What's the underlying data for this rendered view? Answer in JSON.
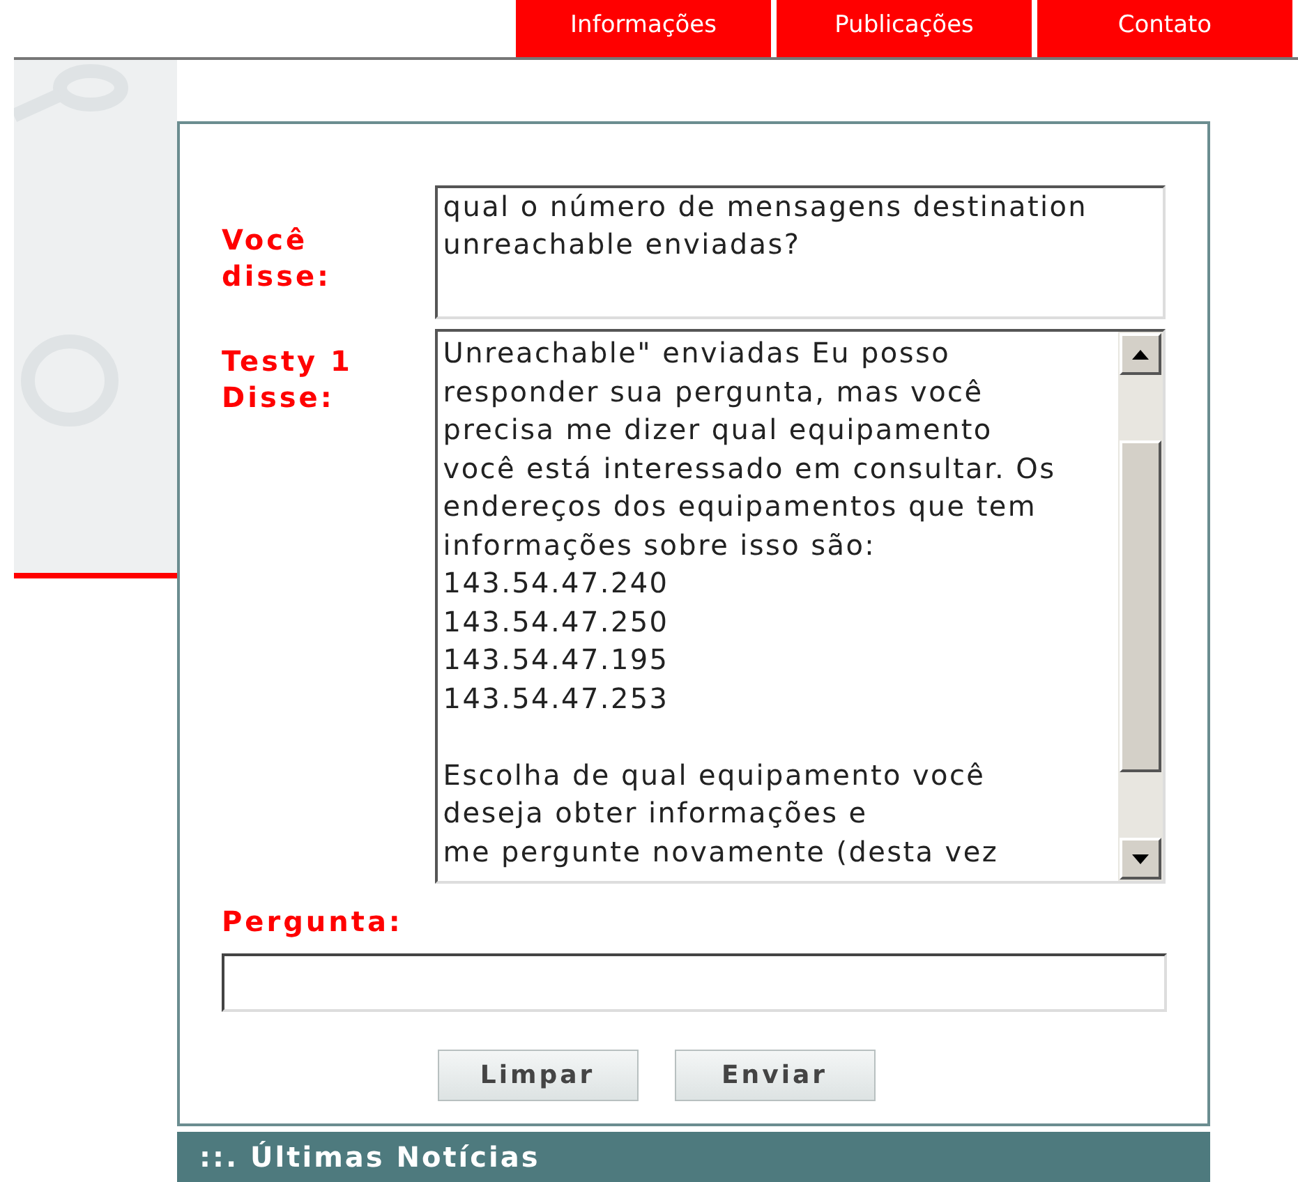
{
  "nav": {
    "tabs": [
      {
        "label": "Informações"
      },
      {
        "label": "Publicações"
      },
      {
        "label": "Contato"
      }
    ]
  },
  "chat": {
    "user_label": "Você disse:",
    "user_message": "qual o número de mensagens destination unreachable enviadas?",
    "bot_label": "Testy 1 Disse:",
    "bot_paragraphs": [
      [
        "Unreachable\" enviadas Eu posso",
        "responder sua pergunta, mas você",
        "precisa me dizer qual equipamento",
        "você está interessado em consultar. Os",
        "endereços dos equipamentos que tem",
        "informações sobre isso são:",
        "143.54.47.240",
        "143.54.47.250",
        "143.54.47.195",
        "143.54.47.253"
      ],
      [
        "Escolha de qual equipamento você",
        "deseja obter informações e",
        "me pergunte novamente (desta vez"
      ]
    ],
    "question_label": "Pergunta:",
    "buttons": [
      "Limpar",
      "Enviar"
    ]
  },
  "news": {
    "title": "::. Últimas Notícias"
  }
}
